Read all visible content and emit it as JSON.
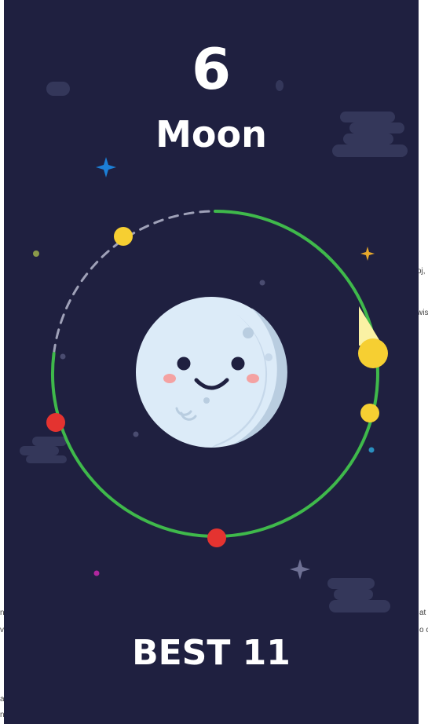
{
  "game": {
    "score": "6",
    "level_name": "Moon",
    "best_label": "BEST 11",
    "progress_fraction": 0.77
  },
  "background_edge_text": {
    "right_1": "oj,",
    "right_2": "wis",
    "right_3": "at",
    "right_4": "o c",
    "left_1": "n",
    "left_2": "v",
    "left_3": "a",
    "left_4": "n"
  },
  "colors": {
    "background": "#1f2040",
    "progress_arc": "#3fb94b",
    "dashed_track": "#9fa1b8",
    "moon": "#dcebf8",
    "moon_shade": "#b9cde0",
    "coin": "#f6cf32",
    "hazard": "#e43330",
    "text": "#ffffff"
  },
  "icons": {
    "planet": "smiling-moon-icon",
    "player": "comet-ball-icon",
    "coin": "yellow-dot-icon",
    "hazard": "red-dot-icon",
    "stars": "sparkle-star-icon",
    "clouds": "cloud-icon"
  }
}
